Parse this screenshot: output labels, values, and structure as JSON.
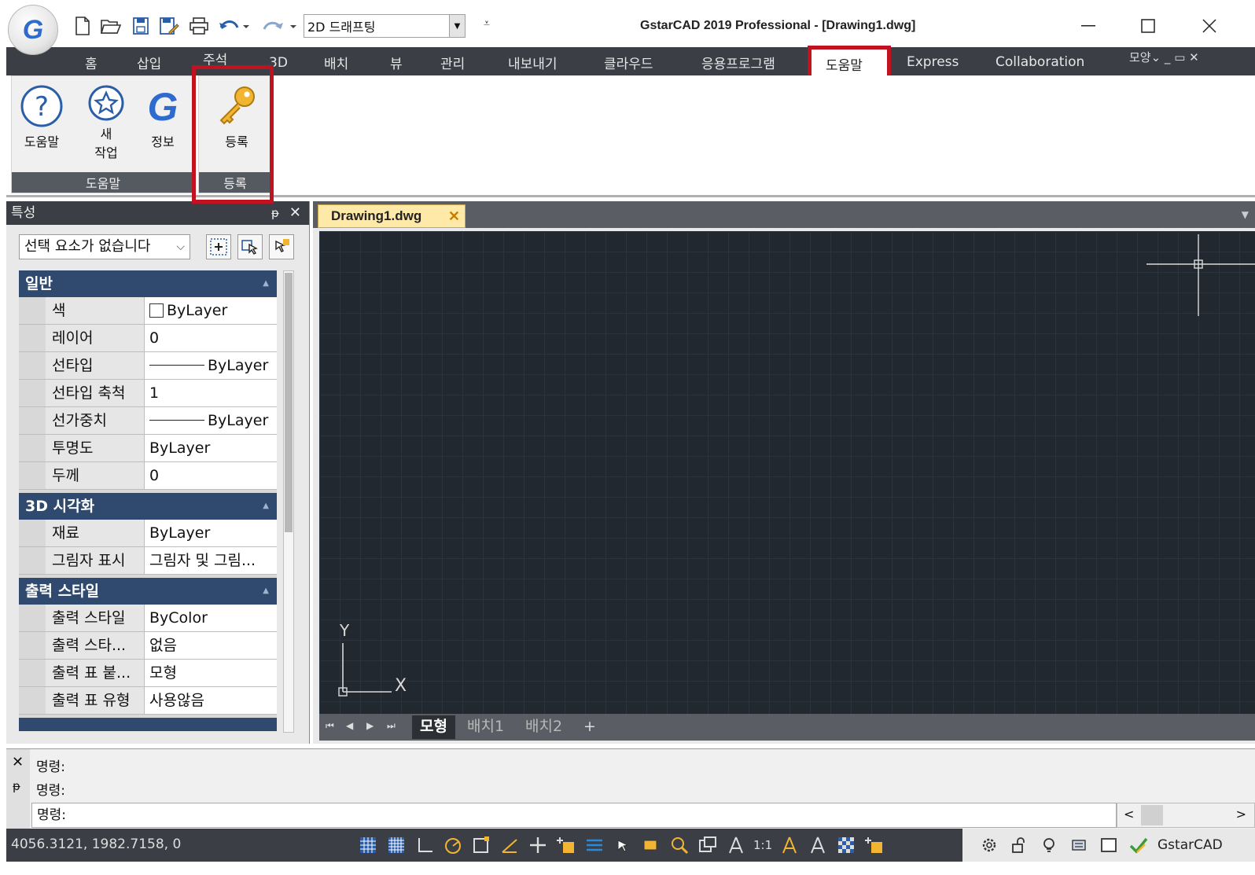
{
  "titlebar": {
    "app_logo_letter": "G",
    "workspace": "2D 드래프팅",
    "window_title": "GstarCAD 2019 Professional - [Drawing1.dwg]",
    "qa_more": "⩡"
  },
  "ribbon_tabs": [
    "홈",
    "삽입",
    "주석",
    "3D",
    "배치",
    "뷰",
    "관리",
    "내보내기",
    "클라우드",
    "응용프로그램",
    "도움말",
    "Express",
    "Collaboration"
  ],
  "ribbon_right": "모양⌄ _ ▭ ✕",
  "ribbon_panels": {
    "help_panel_title": "도움말",
    "register_panel_title": "등록",
    "buttons": {
      "help": "도움말",
      "new_work_line1": "새",
      "new_work_line2": "작업",
      "info": "정보",
      "register": "등록"
    }
  },
  "properties": {
    "title": "특성",
    "pin": "ᵽ",
    "close": "✕",
    "selection": "선택 요소가 없습니다",
    "sections": [
      {
        "name": "일반",
        "rows": [
          {
            "label": "색",
            "value": "ByLayer"
          },
          {
            "label": "레이어",
            "value": "0"
          },
          {
            "label": "선타입",
            "value": "ByLayer"
          },
          {
            "label": "선타입 축척",
            "value": "1"
          },
          {
            "label": "선가중치",
            "value": "ByLayer"
          },
          {
            "label": "투명도",
            "value": "ByLayer"
          },
          {
            "label": "두께",
            "value": "0"
          }
        ]
      },
      {
        "name": "3D 시각화",
        "rows": [
          {
            "label": "재료",
            "value": "ByLayer"
          },
          {
            "label": "그림자 표시",
            "value": "그림자 및 그림..."
          }
        ]
      },
      {
        "name": "출력 스타일",
        "rows": [
          {
            "label": "출력 스타일",
            "value": "ByColor"
          },
          {
            "label": "출력 스타...",
            "value": "없음"
          },
          {
            "label": "출력 표 붙...",
            "value": "모형"
          },
          {
            "label": "출력 표 유형",
            "value": "사용않음"
          }
        ]
      }
    ]
  },
  "document": {
    "tab_name": "Drawing1.dwg",
    "close": "✕",
    "ucs_y": "Y",
    "ucs_x": "X",
    "layout_tabs": [
      "모형",
      "배치1",
      "배치2",
      "+"
    ],
    "nav": [
      "⏮",
      "◀",
      "▶",
      "⏭"
    ]
  },
  "command": {
    "history": [
      "명령:",
      "명령:"
    ],
    "prompt": "명령:",
    "close": "✕",
    "pin": "ᵽ",
    "scroll_left": "<",
    "scroll_right": ">"
  },
  "status": {
    "coordinates": "4056.3121, 1982.7158, 0",
    "scale": "1:1",
    "brand": "GstarCAD"
  },
  "colors": {
    "dark_chrome": "#3b3f45",
    "canvas": "#212830",
    "highlight": "#c1121f",
    "section_header": "#2f4a6e",
    "doc_tab": "#ffe9a8"
  }
}
